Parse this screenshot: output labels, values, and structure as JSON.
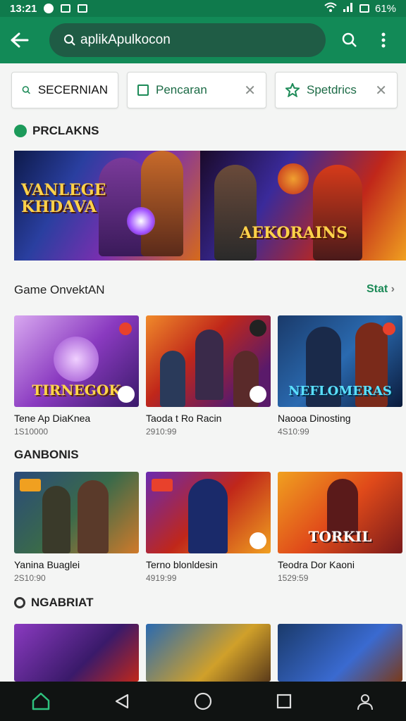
{
  "status": {
    "time": "13:21",
    "battery": "61%"
  },
  "search": {
    "value": "aplikApulkocon"
  },
  "chips": [
    {
      "label": "SECERNIAN",
      "icon": "search-icon"
    },
    {
      "label": "Pencaran",
      "icon": "checkbox-icon"
    },
    {
      "label": "Spetdrics",
      "icon": "star-icon"
    }
  ],
  "sections": {
    "top": "PRCLAKNS",
    "row1": "Game OnvektAN",
    "row1_see_all": "Stat",
    "row2": "GANBONIS",
    "row3": "NGABRIAT"
  },
  "banners": [
    {
      "text": "VANLEGE KHDAVA"
    },
    {
      "text": "AEKORAINS"
    }
  ],
  "row1": [
    {
      "name": "Tene Ap DiaKnea",
      "meta": "1S10000",
      "logo": "TIRNEGOK"
    },
    {
      "name": "Taoda t Ro Racin",
      "meta": "2910:99",
      "logo": ""
    },
    {
      "name": "Naooa Dinosting",
      "meta": "4S10:99",
      "logo": "NEFLOMERAS"
    }
  ],
  "row2": [
    {
      "name": "Yanina Buaglei",
      "meta": "2S10:90",
      "logo": ""
    },
    {
      "name": "Terno blonldesin",
      "meta": "4919:99",
      "logo": ""
    },
    {
      "name": "Teodra Dor Kaoni",
      "meta": "1529:59",
      "logo": "TORKIL"
    }
  ],
  "colors": {
    "brand": "#128a57",
    "accent": "#1c8a57"
  }
}
